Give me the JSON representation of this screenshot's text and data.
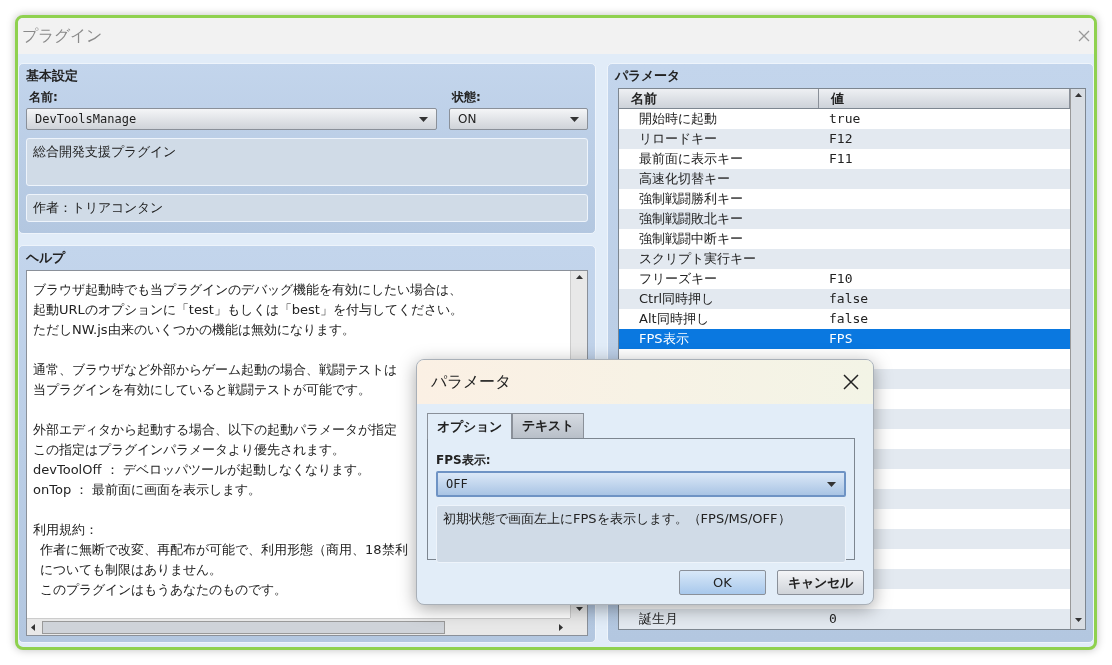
{
  "window": {
    "title": "プラグイン"
  },
  "basic": {
    "heading": "基本設定",
    "name_label": "名前:",
    "name_value": "DevToolsManage",
    "state_label": "状態:",
    "state_value": "ON",
    "description": "総合開発支援プラグイン",
    "author": "作者：トリアコンタン"
  },
  "help": {
    "heading": "ヘルプ",
    "paragraphs": [
      {
        "lines": [
          "ブラウザ起動時でも当プラグインのデバッグ機能を有効にしたい場合は、",
          "起動URLのオプションに「test」もしくは「best」を付与してください。",
          "ただしNW.js由来のいくつかの機能は無効になります。"
        ]
      },
      {
        "lines": [
          "通常、ブラウザなど外部からゲーム起動の場合、戦闘テストは",
          "当プラグインを有効にしていると戦闘テストが可能です。"
        ]
      },
      {
        "lines": [
          "外部エディタから起動する場合、以下の起動パラメータが指定",
          "この指定はプラグインパラメータより優先されます。",
          "devToolOff ： デベロッパツールが起動しなくなります。",
          "onTop ： 最前面に画面を表示します。"
        ]
      },
      {
        "lines": [
          "利用規約："
        ],
        "items": [
          "作者に無断で改変、再配布が可能で、利用形態（商用、18禁利",
          "についても制限はありません。",
          "このプラグインはもうあなたのものです。"
        ]
      }
    ]
  },
  "parameters": {
    "heading": "パラメータ",
    "columns": [
      "名前",
      "値"
    ],
    "rows": [
      {
        "name": "開始時に起動",
        "value": "true",
        "selected": false
      },
      {
        "name": "リロードキー",
        "value": "F12",
        "selected": false
      },
      {
        "name": "最前面に表示キー",
        "value": "F11",
        "selected": false
      },
      {
        "name": "高速化切替キー",
        "selected": false
      },
      {
        "name": "強制戦闘勝利キー",
        "selected": false
      },
      {
        "name": "強制戦闘敗北キー",
        "selected": false
      },
      {
        "name": "強制戦闘中断キー",
        "selected": false
      },
      {
        "name": "スクリプト実行キー",
        "selected": false
      },
      {
        "name": "フリーズキー",
        "value": "F10",
        "selected": false
      },
      {
        "name": "Ctrl同時押し",
        "value": "false",
        "selected": false
      },
      {
        "name": "Alt同時押し",
        "value": "false",
        "selected": false
      },
      {
        "name": "FPS表示",
        "value": "FPS",
        "selected": true
      }
    ],
    "bottom_rows": [
      {
        "name": "誕生月",
        "value": "0",
        "selected": false
      }
    ]
  },
  "dialog": {
    "title": "パラメータ",
    "tabs": [
      {
        "label": "オプション",
        "selected": true
      },
      {
        "label": "テキスト",
        "selected": false
      }
    ],
    "field_label": "FPS表示:",
    "field_value": "OFF",
    "description": "初期状態で画面左上にFPSを表示します。（FPS/MS/OFF）",
    "buttons": [
      {
        "label": "OK",
        "kind": "default"
      },
      {
        "label": "キャンセル",
        "kind": "normal"
      }
    ]
  }
}
